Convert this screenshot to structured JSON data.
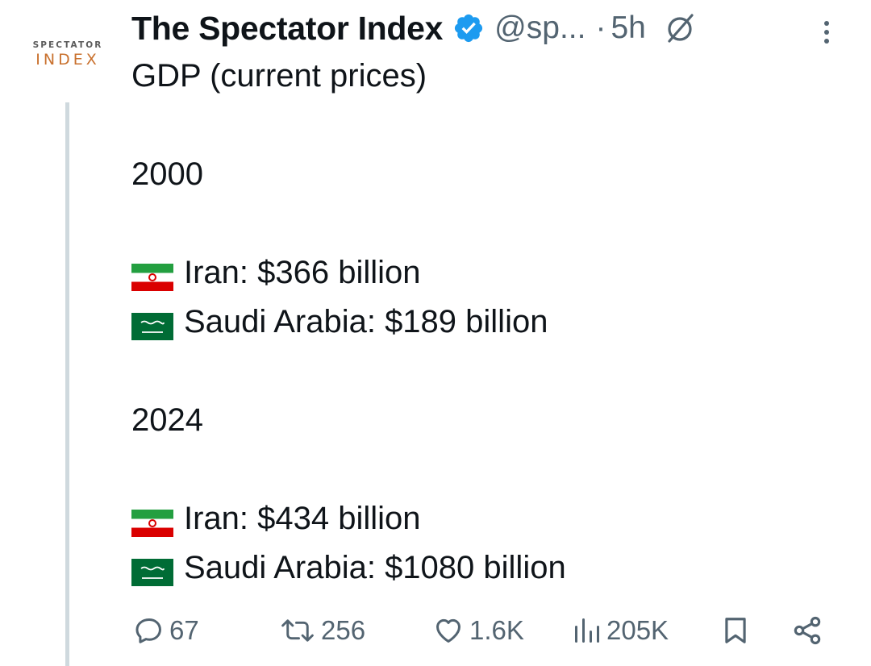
{
  "avatar": {
    "line1": "SPECTATOR",
    "line2": "INDEX",
    "accent_color": "#c9712e"
  },
  "header": {
    "name": "The Spectator Index",
    "verified_icon": "verified-badge-icon",
    "handle": "@sp...",
    "separator": "·",
    "time": "5h",
    "grok_icon": "grok-icon",
    "more_icon": "more-vertical-icon"
  },
  "tweet": {
    "title": "GDP (current prices)",
    "sections": [
      {
        "year": "2000",
        "rows": [
          {
            "flag": "iran-flag-icon",
            "text": "Iran: $366 billion"
          },
          {
            "flag": "saudi-flag-icon",
            "text": "Saudi Arabia: $189 billion"
          }
        ]
      },
      {
        "year": "2024",
        "rows": [
          {
            "flag": "iran-flag-icon",
            "text": "Iran: $434 billion"
          },
          {
            "flag": "saudi-flag-icon",
            "text": "Saudi Arabia: $1080 billion"
          }
        ]
      }
    ]
  },
  "actions": {
    "replies": "67",
    "reposts": "256",
    "likes": "1.6K",
    "views": "205K",
    "bookmark_icon": "bookmark-icon",
    "share_icon": "share-icon"
  },
  "colors": {
    "text": "#0f1419",
    "secondary": "#536471",
    "verified": "#1d9bf0",
    "thread_line": "#cfd9de"
  }
}
